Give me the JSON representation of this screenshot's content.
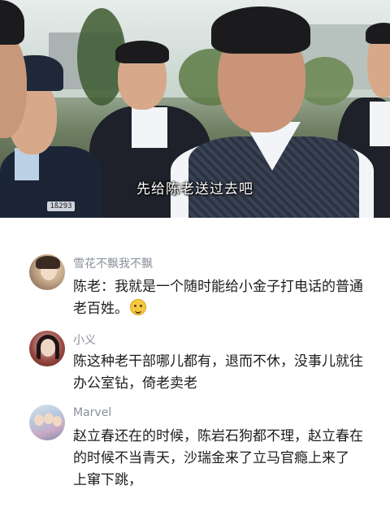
{
  "video": {
    "subtitle": "先给陈老送过去吧",
    "badge_number": "1ß293"
  },
  "comments": [
    {
      "username": "雪花不飘我不飘",
      "text": "陈老：我就是一个随时能给小金子打电话的普通老百姓。",
      "emoji": "smiling-face-emoji"
    },
    {
      "username": "小义",
      "text": "陈这种老干部哪儿都有，退而不休，没事儿就往办公室钻，倚老卖老"
    },
    {
      "username": "Marvel",
      "text": "赵立春还在的时候，陈岩石狗都不理，赵立春在的时候不当青天，沙瑞金来了立马官瘾上来了 上窜下跳，"
    }
  ],
  "colors": {
    "username": "#8a8f99",
    "body_text": "#1c1c1c",
    "background": "#ffffff"
  }
}
